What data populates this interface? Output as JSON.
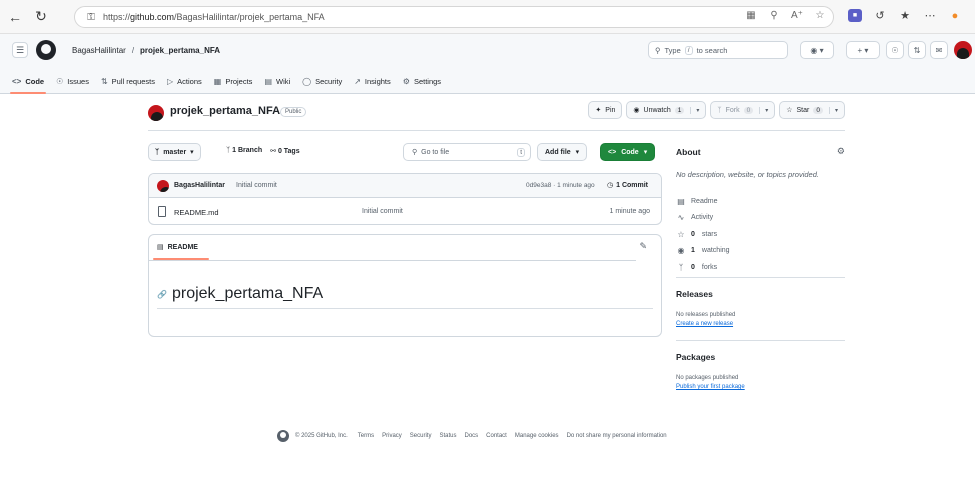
{
  "browser": {
    "url_prefix": "https://",
    "url_host": "github.com",
    "url_path": "/BagasHalilintar/projek_pertama_NFA"
  },
  "header": {
    "owner": "BagasHalilintar",
    "separator": "/",
    "repo": "projek_pertama_NFA",
    "search_prefix": "Type",
    "search_key": "/",
    "search_suffix": "to search"
  },
  "tabs": [
    {
      "label": "Code",
      "icon": "code-icon"
    },
    {
      "label": "Issues",
      "icon": "issue-icon"
    },
    {
      "label": "Pull requests",
      "icon": "pull-request-icon"
    },
    {
      "label": "Actions",
      "icon": "play-icon"
    },
    {
      "label": "Projects",
      "icon": "table-icon"
    },
    {
      "label": "Wiki",
      "icon": "book-icon"
    },
    {
      "label": "Security",
      "icon": "shield-icon"
    },
    {
      "label": "Insights",
      "icon": "graph-icon"
    },
    {
      "label": "Settings",
      "icon": "gear-icon"
    }
  ],
  "repo": {
    "name": "projek_pertama_NFA",
    "visibility": "Public",
    "pin_label": "Pin",
    "watch_label": "Unwatch",
    "watch_count": "1",
    "fork_label": "Fork",
    "fork_count": "0",
    "star_label": "Star",
    "star_count": "0"
  },
  "file_nav": {
    "branch": "master",
    "branch_count": "1 Branch",
    "tag_count": "0 Tags",
    "goto_placeholder": "Go to file",
    "goto_key": "t",
    "add_file": "Add file",
    "code_button": "Code"
  },
  "commit": {
    "author": "BagasHalilintar",
    "message": "Initial commit",
    "hash_age": "0d9e3a8 · 1 minute ago",
    "count": "1 Commit"
  },
  "files": [
    {
      "name": "README.md",
      "commit": "Initial commit",
      "age": "1 minute ago"
    }
  ],
  "readme": {
    "tab_label": "README",
    "title": "projek_pertama_NFA"
  },
  "sidebar": {
    "about_title": "About",
    "description": "No description, website, or topics provided.",
    "items": [
      {
        "icon": "book-icon",
        "bold": "",
        "label": "Readme"
      },
      {
        "icon": "pulse-icon",
        "bold": "",
        "label": "Activity"
      },
      {
        "icon": "star-icon",
        "bold": "0",
        "label": "stars"
      },
      {
        "icon": "eye-icon",
        "bold": "1",
        "label": "watching"
      },
      {
        "icon": "fork-icon",
        "bold": "0",
        "label": "forks"
      }
    ],
    "releases_title": "Releases",
    "releases_text": "No releases published",
    "releases_link": "Create a new release",
    "packages_title": "Packages",
    "packages_text": "No packages published",
    "packages_link": "Publish your first package"
  },
  "footer": {
    "copyright": "© 2025 GitHub, Inc.",
    "links": [
      "Terms",
      "Privacy",
      "Security",
      "Status",
      "Docs",
      "Contact",
      "Manage cookies",
      "Do not share my personal information"
    ]
  }
}
